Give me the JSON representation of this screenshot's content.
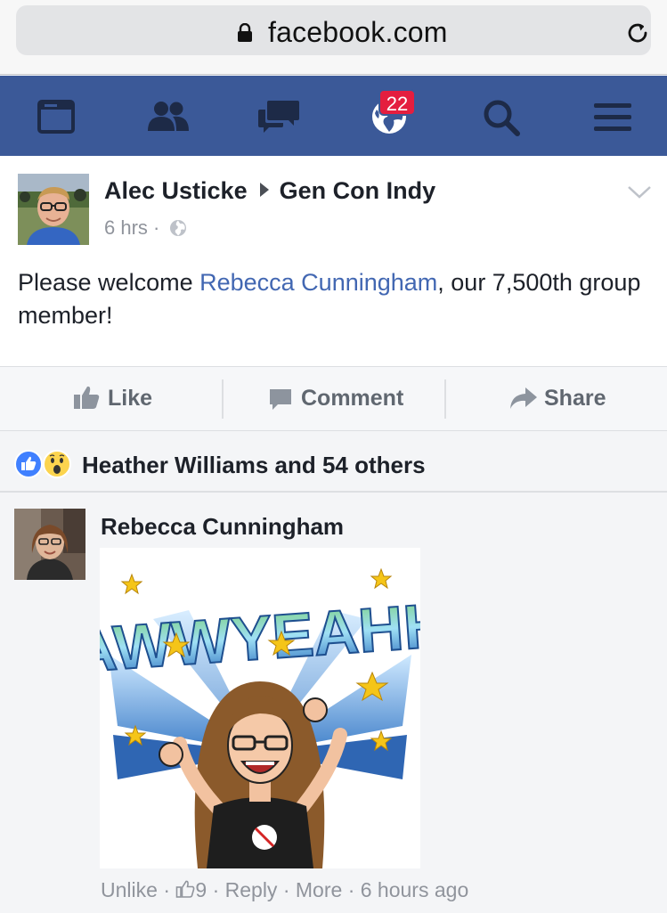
{
  "browser": {
    "url": "facebook.com"
  },
  "nav": {
    "items": [
      "news-feed",
      "friend-requests",
      "messages",
      "notifications",
      "search",
      "menu"
    ],
    "notification_count": "22",
    "brand_color": "#3b5998"
  },
  "post": {
    "author": "Alec Usticke",
    "group": "Gen Con Indy",
    "time": "6 hrs",
    "separator": "·",
    "text_before": "Please welcome ",
    "mention": "Rebecca Cunningham",
    "text_after": ", our 7,500th group member!",
    "audience_icon": "globe-icon"
  },
  "actions": {
    "like": "Like",
    "comment": "Comment",
    "share": "Share"
  },
  "reactions": {
    "summary": "Heather Williams and 54 others",
    "types": [
      "like",
      "wow"
    ]
  },
  "comment": {
    "author": "Rebecca Cunningham",
    "sticker_text": "AWWYEAHH",
    "unlike": "Unlike",
    "likes": "9",
    "reply": "Reply",
    "more": "More",
    "time": "6 hours ago",
    "dot": "·"
  }
}
